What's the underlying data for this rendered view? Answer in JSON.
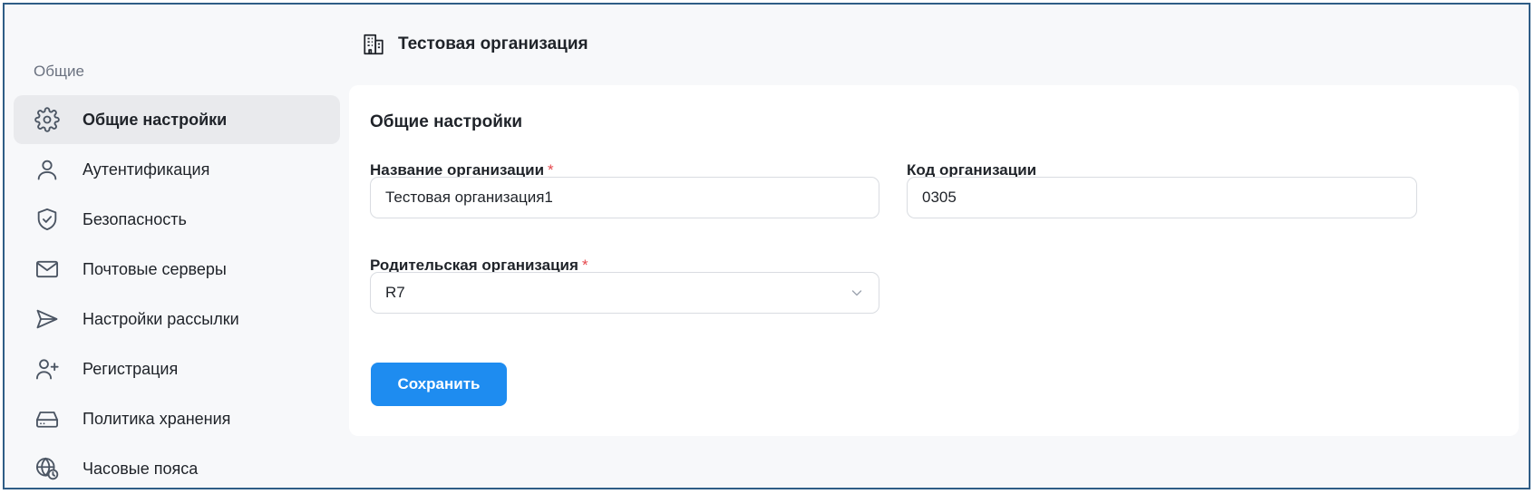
{
  "sidebar": {
    "section_label": "Общие",
    "items": [
      {
        "label": "Общие настройки",
        "icon": "gear-icon",
        "active": true
      },
      {
        "label": "Аутентификация",
        "icon": "user-icon",
        "active": false
      },
      {
        "label": "Безопасность",
        "icon": "shield-check-icon",
        "active": false
      },
      {
        "label": "Почтовые серверы",
        "icon": "mail-icon",
        "active": false
      },
      {
        "label": "Настройки рассылки",
        "icon": "send-icon",
        "active": false
      },
      {
        "label": "Регистрация",
        "icon": "user-plus-icon",
        "active": false
      },
      {
        "label": "Политика хранения",
        "icon": "hard-drive-icon",
        "active": false
      },
      {
        "label": "Часовые пояса",
        "icon": "globe-clock-icon",
        "active": false
      }
    ]
  },
  "header": {
    "icon": "building-icon",
    "title": "Тестовая организация"
  },
  "form": {
    "title": "Общие настройки",
    "org_name": {
      "label": "Название организации",
      "required_mark": "*",
      "value": "Тестовая организация1"
    },
    "org_code": {
      "label": "Код организации",
      "value": "0305"
    },
    "parent_org": {
      "label": "Родительская организация",
      "required_mark": "*",
      "value": "R7"
    },
    "save_label": "Сохранить"
  },
  "colors": {
    "accent": "#1e8cf0",
    "required": "#e5484d",
    "frame_border": "#2f5d86"
  }
}
